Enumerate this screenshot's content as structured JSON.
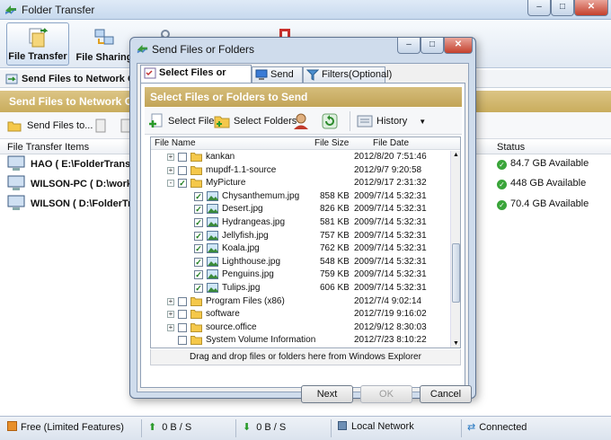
{
  "main": {
    "title": "Folder Transfer",
    "toolbar": [
      {
        "label": "File Transfer",
        "active": true
      },
      {
        "label": "File Sharing",
        "active": false
      }
    ],
    "section_title": "Send Files to Network Co",
    "band_title": "Send Files to Network C",
    "send_button": "Send Files to...",
    "list_header": {
      "items": "File Transfer Items",
      "status": "Status"
    },
    "machines": [
      {
        "label": "HAO ( E:\\FolderTransfer",
        "status": "84.7 GB Available"
      },
      {
        "label": "WILSON-PC ( D:\\work\\Fol",
        "status": "448 GB Available"
      },
      {
        "label": "WILSON ( D:\\FolderTransf",
        "status": "70.4 GB Available"
      }
    ],
    "statusbar": {
      "edition": "Free (Limited Features)",
      "up": "0 B / S",
      "down": "0 B / S",
      "network": "Local Network",
      "state": "Connected"
    }
  },
  "dialog": {
    "title": "Send Files or Folders",
    "tabs": [
      "Select Files or Folders",
      "Send to",
      "Filters(Optional)"
    ],
    "band_title": "Select Files or Folders to Send",
    "tools": {
      "select_files": "Select Files",
      "select_folders": "Select Folders",
      "history": "History"
    },
    "columns": {
      "name": "File Name",
      "size": "File Size",
      "date": "File Date"
    },
    "rows": [
      {
        "name": "kankan",
        "size": "",
        "date": "2012/8/20 7:51:46",
        "kind": "folder",
        "checked": false,
        "expander": "+"
      },
      {
        "name": "mupdf-1.1-source",
        "size": "",
        "date": "2012/9/7 9:20:58",
        "kind": "folder",
        "checked": false,
        "expander": "+"
      },
      {
        "name": "MyPicture",
        "size": "",
        "date": "2012/9/17 2:31:32",
        "kind": "folder",
        "checked": true,
        "expander": "-"
      },
      {
        "name": "Chysanthemum.jpg",
        "size": "858 KB",
        "date": "2009/7/14 5:32:31",
        "kind": "image",
        "checked": true,
        "expander": ""
      },
      {
        "name": "Desert.jpg",
        "size": "826 KB",
        "date": "2009/7/14 5:32:31",
        "kind": "image",
        "checked": true,
        "expander": ""
      },
      {
        "name": "Hydrangeas.jpg",
        "size": "581 KB",
        "date": "2009/7/14 5:32:31",
        "kind": "image",
        "checked": true,
        "expander": ""
      },
      {
        "name": "Jellyfish.jpg",
        "size": "757 KB",
        "date": "2009/7/14 5:32:31",
        "kind": "image",
        "checked": true,
        "expander": ""
      },
      {
        "name": "Koala.jpg",
        "size": "762 KB",
        "date": "2009/7/14 5:32:31",
        "kind": "image",
        "checked": true,
        "expander": ""
      },
      {
        "name": "Lighthouse.jpg",
        "size": "548 KB",
        "date": "2009/7/14 5:32:31",
        "kind": "image",
        "checked": true,
        "expander": ""
      },
      {
        "name": "Penguins.jpg",
        "size": "759 KB",
        "date": "2009/7/14 5:32:31",
        "kind": "image",
        "checked": true,
        "expander": ""
      },
      {
        "name": "Tulips.jpg",
        "size": "606 KB",
        "date": "2009/7/14 5:32:31",
        "kind": "image",
        "checked": true,
        "expander": ""
      },
      {
        "name": "Program Files (x86)",
        "size": "",
        "date": "2012/7/4 9:02:14",
        "kind": "folder",
        "checked": false,
        "expander": "+"
      },
      {
        "name": "software",
        "size": "",
        "date": "2012/7/19 9:16:02",
        "kind": "folder",
        "checked": false,
        "expander": "+"
      },
      {
        "name": "source.office",
        "size": "",
        "date": "2012/9/12 8:30:03",
        "kind": "folder",
        "checked": false,
        "expander": "+"
      },
      {
        "name": "System Volume Information",
        "size": "",
        "date": "2012/7/23 8:10:22",
        "kind": "folder",
        "checked": false,
        "expander": ""
      }
    ],
    "hint": "Drag and drop files or folders here from Windows Explorer",
    "buttons": {
      "next": "Next",
      "ok": "OK",
      "cancel": "Cancel"
    }
  }
}
